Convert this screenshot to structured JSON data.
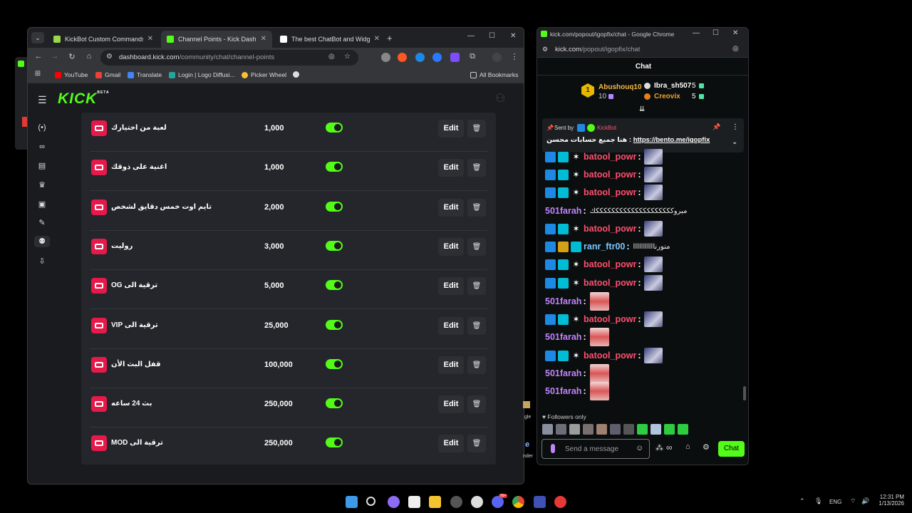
{
  "main_window": {
    "tabs": [
      {
        "title": "KickBot Custom Commands",
        "active": false
      },
      {
        "title": "Channel Points - Kick Dashboard",
        "active": true
      },
      {
        "title": "The best ChatBot and Widgets",
        "active": false
      }
    ],
    "url_host": "dashboard.kick.com",
    "url_path": "/community/chat/channel-points",
    "bookmarks": [
      "YouTube",
      "Gmail",
      "Translate",
      "Login | Logo Diffusi...",
      "Picker Wheel",
      "All Bookmarks"
    ],
    "logo_text": "KICK",
    "logo_beta": "BETA",
    "sidebar_icons": [
      "broadcast-icon",
      "link-icon",
      "chart-icon",
      "trophy-icon",
      "media-icon",
      "wrench-icon",
      "community-icon",
      "download-icon"
    ],
    "rewards": [
      {
        "name": "لعبة من اختيارك",
        "cost": "1,000",
        "enabled": true
      },
      {
        "name": "اغنية على ذوقك",
        "cost": "1,000",
        "enabled": true
      },
      {
        "name": "تايم اوت خمس دقايق لشخص",
        "cost": "2,000",
        "enabled": true
      },
      {
        "name": "روليت",
        "cost": "3,000",
        "enabled": true
      },
      {
        "name": "ترقية الى OG",
        "cost": "5,000",
        "enabled": true
      },
      {
        "name": "ترقية الى VIP",
        "cost": "25,000",
        "enabled": true
      },
      {
        "name": "قفل البث الأن",
        "cost": "100,000",
        "enabled": true
      },
      {
        "name": "بث 24 ساعه",
        "cost": "250,000",
        "enabled": true
      },
      {
        "name": "ترقية الى MOD",
        "cost": "250,000",
        "enabled": true
      }
    ],
    "edit_label": "Edit",
    "delete_glyph": "🗑",
    "gap_items": [
      "gle",
      "e",
      "nder"
    ]
  },
  "popout": {
    "title": "kick.com/popout/igopfix/chat - Google Chrome",
    "addr_host": "kick.com",
    "addr_path": "/popout/igopfix/chat",
    "chat_title": "Chat",
    "leaderboard": [
      {
        "name": "Abushouq10",
        "score": "10",
        "rank": "1"
      },
      {
        "name": "Ibra_sh507",
        "score": "5"
      },
      {
        "name": "Creovix",
        "score": "5"
      }
    ],
    "pinned": {
      "sent_by_label": "Sent by",
      "sender": "KickBot",
      "text": "هنا جميع حسابات محسن : ",
      "link": "https://bento.me/igopfix"
    },
    "messages": [
      {
        "user": "batool_powr",
        "color": "#ff4f6d",
        "badges": [
          "blue",
          "teal",
          "star"
        ],
        "text": "",
        "emote": "blue"
      },
      {
        "user": "batool_powr",
        "color": "#ff4f6d",
        "badges": [
          "blue",
          "teal",
          "star"
        ],
        "text": "",
        "emote": "blue"
      },
      {
        "user": "batool_powr",
        "color": "#ff4f6d",
        "badges": [
          "blue",
          "teal",
          "star"
        ],
        "text": "",
        "emote": "blue"
      },
      {
        "user": "501farah",
        "color": "#c084fc",
        "badges": [],
        "text": "مبروككككككككككككككككككككك",
        "emote": ""
      },
      {
        "user": "batool_powr",
        "color": "#ff4f6d",
        "badges": [
          "blue",
          "teal",
          "star"
        ],
        "text": "",
        "emote": "blue"
      },
      {
        "user": "ranr_ftr00",
        "color": "#7cc7ff",
        "badges": [
          "blue",
          "gold",
          "teal"
        ],
        "text": "منورنااااااااااا",
        "emote": ""
      },
      {
        "user": "batool_powr",
        "color": "#ff4f6d",
        "badges": [
          "blue",
          "teal",
          "star"
        ],
        "text": "",
        "emote": "blue"
      },
      {
        "user": "batool_powr",
        "color": "#ff4f6d",
        "badges": [
          "blue",
          "teal",
          "star"
        ],
        "text": "",
        "emote": "blue"
      },
      {
        "user": "501farah",
        "color": "#c084fc",
        "badges": [],
        "text": "",
        "emote": "red"
      },
      {
        "user": "batool_powr",
        "color": "#ff4f6d",
        "badges": [
          "blue",
          "teal",
          "star"
        ],
        "text": "",
        "emote": "blue"
      },
      {
        "user": "501farah",
        "color": "#c084fc",
        "badges": [],
        "text": "",
        "emote": "red"
      },
      {
        "user": "batool_powr",
        "color": "#ff4f6d",
        "badges": [
          "blue",
          "teal",
          "star"
        ],
        "text": "",
        "emote": "blue"
      },
      {
        "user": "501farah",
        "color": "#c084fc",
        "badges": [],
        "text": "",
        "emote": "red"
      },
      {
        "user": "501farah",
        "color": "#c084fc",
        "badges": [],
        "text": "",
        "emote": "red"
      }
    ],
    "followers_only": "Followers only",
    "input_placeholder": "Send a message",
    "chat_button": "Chat",
    "emote_bar_count": 11
  },
  "taskbar": {
    "lang": "ENG",
    "time": "12:31 PM",
    "date": "1/13/2026",
    "discord_badge": "99+"
  },
  "colors": {
    "kick_green": "#53fc18",
    "reward_red": "#e6194b",
    "page_bg": "#191b1f"
  }
}
